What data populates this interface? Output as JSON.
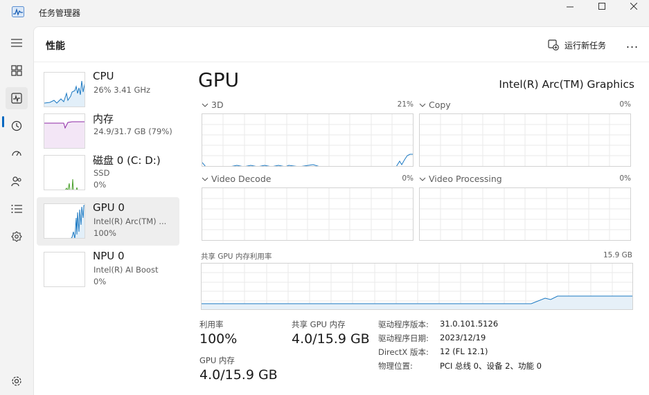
{
  "window": {
    "title": "任务管理器"
  },
  "header": {
    "title": "性能",
    "run_task": "运行新任务",
    "more": "..."
  },
  "nav": [
    "menu-icon",
    "processes-icon",
    "performance-icon",
    "app-history-icon",
    "startup-icon",
    "users-icon",
    "details-icon",
    "services-icon",
    "settings-icon"
  ],
  "devices": [
    {
      "name": "CPU",
      "line1": "26%  3.41 GHz",
      "line2": ""
    },
    {
      "name": "内存",
      "line1": "24.9/31.7 GB (79%)",
      "line2": ""
    },
    {
      "name": "磁盘 0 (C: D:)",
      "line1": "SSD",
      "line2": "0%"
    },
    {
      "name": "GPU 0",
      "line1": "Intel(R) Arc(TM) ...",
      "line2": "100%"
    },
    {
      "name": "NPU 0",
      "line1": "Intel(R) AI Boost",
      "line2": "0%"
    }
  ],
  "gpu": {
    "title": "GPU",
    "name": "Intel(R) Arc(TM) Graphics",
    "graphs": [
      {
        "label": "3D",
        "pct": "21%"
      },
      {
        "label": "Copy",
        "pct": "0%"
      },
      {
        "label": "Video Decode",
        "pct": "0%"
      },
      {
        "label": "Video Processing",
        "pct": "0%"
      }
    ],
    "shared_mem_label": "共享 GPU 内存利用率",
    "shared_mem_cap": "15.9 GB",
    "stats": {
      "util_label": "利用率",
      "util_value": "100%",
      "shared_label": "共享 GPU 内存",
      "shared_value": "4.0/15.9 GB",
      "gpumem_label": "GPU 内存",
      "gpumem_value": "4.0/15.9 GB"
    },
    "details": [
      {
        "k": "驱动程序版本:",
        "v": "31.0.101.5126"
      },
      {
        "k": "驱动程序日期:",
        "v": "2023/12/19"
      },
      {
        "k": "DirectX 版本:",
        "v": "12 (FL 12.1)"
      },
      {
        "k": "物理位置:",
        "v": "PCI 总线 0、设备 2、功能 0"
      }
    ]
  },
  "colors": {
    "gpu": "#1a78c2",
    "memory": "#8e2aa6",
    "disk": "#4aa02c",
    "accent": "#0067c0"
  }
}
